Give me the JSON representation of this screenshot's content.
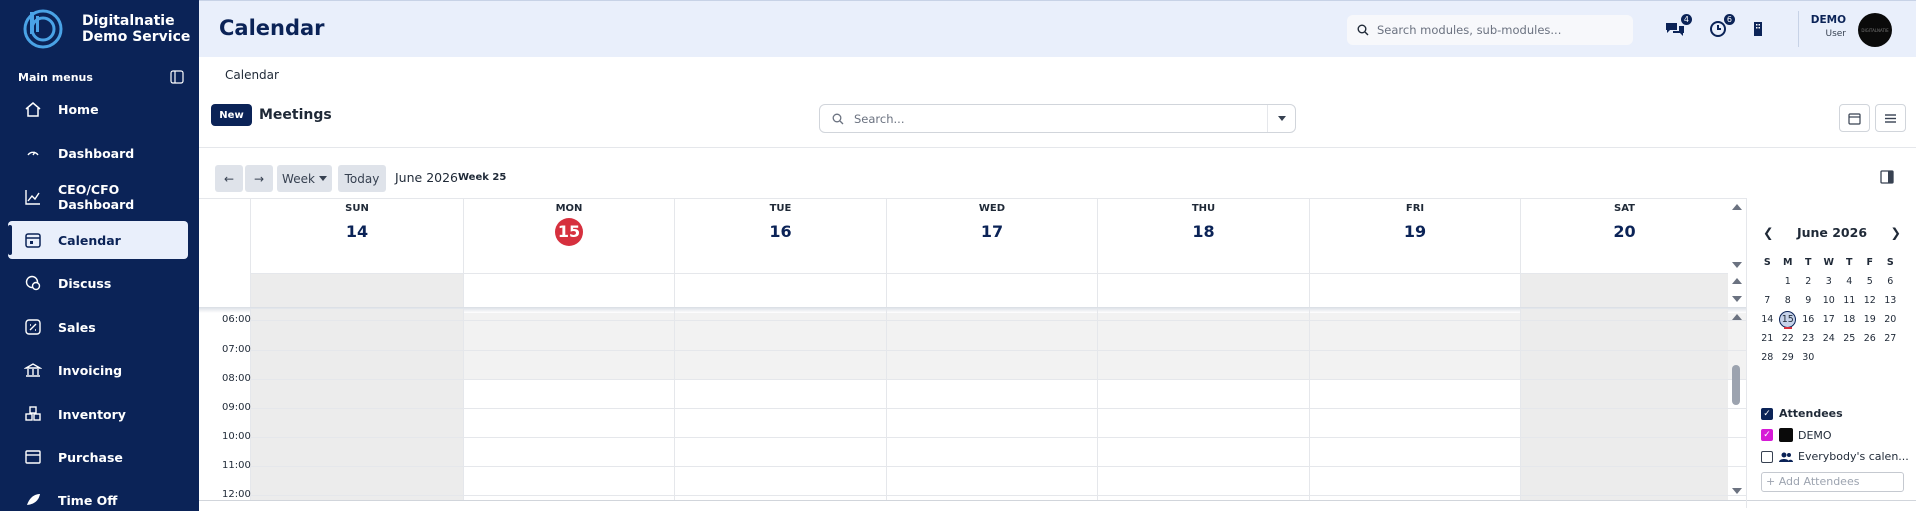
{
  "brand": {
    "line1": "Digitalnatie",
    "line2": "Demo Service"
  },
  "sidebar": {
    "menu_heading": "Main menus",
    "items": [
      {
        "label": "Home",
        "icon": "home-icon"
      },
      {
        "label": "Dashboard",
        "icon": "gauge-icon"
      },
      {
        "label": "CEO/CFO Dashboard",
        "icon": "chart-icon"
      },
      {
        "label": "Calendar",
        "icon": "calendar-icon",
        "active": true
      },
      {
        "label": "Discuss",
        "icon": "chat-icon"
      },
      {
        "label": "Sales",
        "icon": "sales-icon"
      },
      {
        "label": "Invoicing",
        "icon": "bank-icon"
      },
      {
        "label": "Inventory",
        "icon": "boxes-icon"
      },
      {
        "label": "Purchase",
        "icon": "cart-icon"
      },
      {
        "label": "Time Off",
        "icon": "plane-icon"
      }
    ]
  },
  "header": {
    "title": "Calendar",
    "search_placeholder": "Search modules, sub-modules...",
    "messages_badge": "4",
    "activity_badge": "6",
    "user_name": "DEMO",
    "user_role": "User",
    "avatar_text": "DIGITALNATIE"
  },
  "control": {
    "breadcrumb": "Calendar",
    "new_label": "New",
    "title": "Meetings",
    "search_placeholder": "Search..."
  },
  "toolbar": {
    "prev": "←",
    "next": "→",
    "scale": "Week",
    "today": "Today",
    "month": "June 2026",
    "week": "Week 25"
  },
  "days": [
    {
      "name": "SUN",
      "num": "14"
    },
    {
      "name": "MON",
      "num": "15",
      "today": true
    },
    {
      "name": "TUE",
      "num": "16"
    },
    {
      "name": "WED",
      "num": "17"
    },
    {
      "name": "THU",
      "num": "18"
    },
    {
      "name": "FRI",
      "num": "19"
    },
    {
      "name": "SAT",
      "num": "20"
    }
  ],
  "hours": [
    "06:00",
    "07:00",
    "08:00",
    "09:00",
    "10:00",
    "11:00",
    "12:00"
  ],
  "mini_calendar": {
    "title": "June 2026",
    "weekdays": [
      "S",
      "M",
      "T",
      "W",
      "T",
      "F",
      "S"
    ],
    "weeks": [
      [
        "",
        "1",
        "2",
        "3",
        "4",
        "5",
        "6"
      ],
      [
        "7",
        "8",
        "9",
        "10",
        "11",
        "12",
        "13"
      ],
      [
        "14",
        "15",
        "16",
        "17",
        "18",
        "19",
        "20"
      ],
      [
        "21",
        "22",
        "23",
        "24",
        "25",
        "26",
        "27"
      ],
      [
        "28",
        "29",
        "30",
        "",
        "",
        "",
        ""
      ]
    ],
    "selected": "15"
  },
  "attendees": {
    "heading": "Attendees",
    "me": "DEMO",
    "everybody": "Everybody's calen...",
    "add_placeholder": "+ Add Attendees"
  },
  "colors": {
    "sidebar_bg": "#0b2357",
    "accent": "#0b2357",
    "today": "#d6303e",
    "attendee": "#d61ad6"
  }
}
